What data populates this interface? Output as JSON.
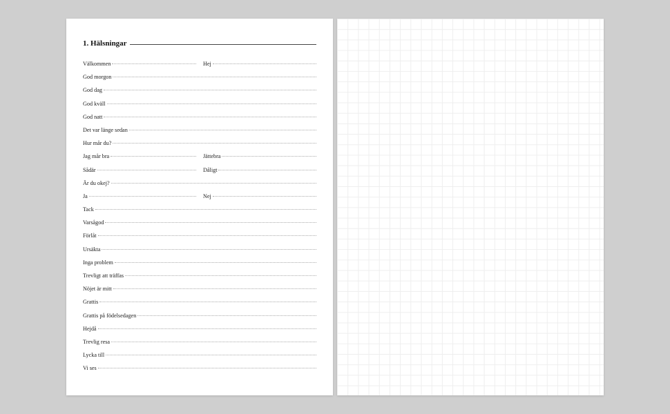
{
  "title": "1. Hälsningar",
  "rows": [
    {
      "cells": [
        "Välkommen",
        "Hej"
      ]
    },
    {
      "cells": [
        "God morgon"
      ]
    },
    {
      "cells": [
        "God dag"
      ]
    },
    {
      "cells": [
        "God kväll"
      ]
    },
    {
      "cells": [
        "God natt"
      ]
    },
    {
      "cells": [
        "Det var länge sedan"
      ]
    },
    {
      "cells": [
        "Hur mår du?"
      ]
    },
    {
      "cells": [
        "Jag mår bra",
        "Jättebra"
      ]
    },
    {
      "cells": [
        "Sådär",
        "Dåligt"
      ]
    },
    {
      "cells": [
        "Är du okej?"
      ]
    },
    {
      "cells": [
        "Ja",
        "Nej"
      ]
    },
    {
      "cells": [
        "Tack"
      ]
    },
    {
      "cells": [
        "Varsågod"
      ]
    },
    {
      "cells": [
        "Förlåt"
      ]
    },
    {
      "cells": [
        "Ursäkta"
      ]
    },
    {
      "cells": [
        "Inga problem"
      ]
    },
    {
      "cells": [
        "Trevligt att träffas"
      ]
    },
    {
      "cells": [
        "Nöjet är mitt"
      ]
    },
    {
      "cells": [
        "Grattis"
      ]
    },
    {
      "cells": [
        "Grattis på födelsedagen"
      ]
    },
    {
      "cells": [
        "Hejdå"
      ]
    },
    {
      "cells": [
        "Trevlig resa"
      ]
    },
    {
      "cells": [
        "Lycka till"
      ]
    },
    {
      "cells": [
        "Vi ses"
      ]
    }
  ]
}
